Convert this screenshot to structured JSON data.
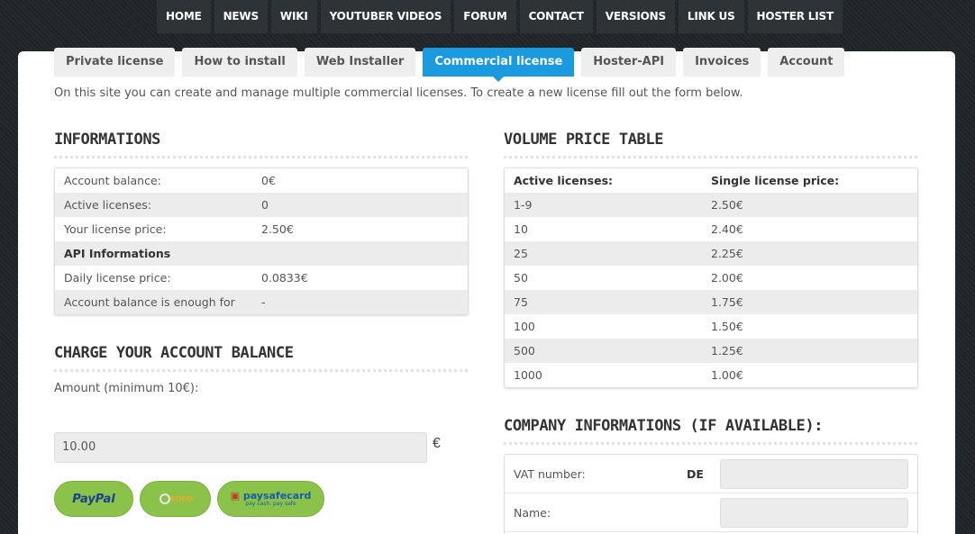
{
  "topnav": [
    "HOME",
    "NEWS",
    "WIKI",
    "YOUTUBER VIDEOS",
    "FORUM",
    "CONTACT",
    "VERSIONS",
    "LINK US",
    "HOSTER LIST"
  ],
  "subtabs": [
    "Private license",
    "How to install",
    "Web Installer",
    "Commercial license",
    "Hoster-API",
    "Invoices",
    "Account"
  ],
  "active_subtab": "Commercial license",
  "intro": "On this site you can create and manage multiple commercial licenses. To create a new license fill out the form below.",
  "informations": {
    "title": "INFORMATIONS",
    "rows": [
      {
        "label": "Account balance:",
        "value": "0€"
      },
      {
        "label": "Active licenses:",
        "value": "0"
      },
      {
        "label": "Your license price:",
        "value": "2.50€"
      },
      {
        "label": "API Informations",
        "value": ""
      },
      {
        "label": "Daily license price:",
        "value": "0.0833€"
      },
      {
        "label": "Account balance is enough for",
        "value": "-"
      }
    ]
  },
  "charge": {
    "title": "CHARGE YOUR ACCOUNT BALANCE",
    "amount_label": "Amount (minimum 10€):",
    "amount_value": "10.00",
    "currency": "€",
    "paypal_label": "PayPal",
    "sofort_label": "SOFORT",
    "paysafecard_label": "paysafecard",
    "paysafecard_sub": "pay cash. pay safe"
  },
  "volume": {
    "title": "VOLUME PRICE TABLE",
    "headers": [
      "Active licenses:",
      "Single license price:"
    ],
    "rows": [
      [
        "1-9",
        "2.50€"
      ],
      [
        "10",
        "2.40€"
      ],
      [
        "25",
        "2.25€"
      ],
      [
        "50",
        "2.00€"
      ],
      [
        "75",
        "1.75€"
      ],
      [
        "100",
        "1.50€"
      ],
      [
        "500",
        "1.25€"
      ],
      [
        "1000",
        "1.00€"
      ]
    ]
  },
  "company": {
    "title": "COMPANY INFORMATIONS (IF AVAILABLE):",
    "vat_label": "VAT number:",
    "vat_prefix": "DE",
    "name_label": "Name:"
  },
  "colors": {
    "accent": "#1a9be0",
    "pay_button": "#8bc34a",
    "page_bg": "#23282d"
  }
}
